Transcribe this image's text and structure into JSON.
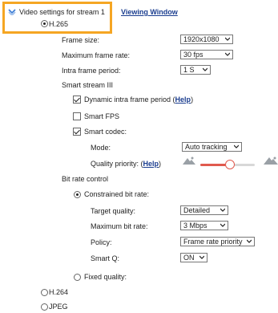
{
  "header": {
    "title": "Video settings for stream 1",
    "viewing_window_link": "Viewing Window"
  },
  "codec": {
    "h265_label": "H.265",
    "h264_label": "H.264",
    "jpeg_label": "JPEG",
    "selected": "H.265"
  },
  "fields": {
    "frame_size_label": "Frame size:",
    "frame_size_value": "1920x1080",
    "max_frame_rate_label": "Maximum frame rate:",
    "max_frame_rate_value": "30 fps",
    "intra_frame_period_label": "Intra frame period:",
    "intra_frame_period_value": "1 S"
  },
  "smart_stream": {
    "title": "Smart stream III",
    "dynamic_intra_label": "Dynamic intra frame period (",
    "dynamic_intra_help": "Help",
    "dynamic_intra_close": ")",
    "dynamic_intra_checked": true,
    "smart_fps_label": "Smart FPS",
    "smart_fps_checked": false,
    "smart_codec_label": "Smart codec:",
    "smart_codec_checked": true,
    "mode_label": "Mode:",
    "mode_value": "Auto tracking",
    "quality_priority_label": "Quality priority: (",
    "quality_priority_help": "Help",
    "quality_priority_close": ")",
    "quality_priority_level": 0.55,
    "accent_color": "#e05a4e"
  },
  "bitrate": {
    "title": "Bit rate control",
    "constrained_label": "Constrained bit rate:",
    "constrained_selected": true,
    "target_quality_label": "Target quality:",
    "target_quality_value": "Detailed",
    "max_bitrate_label": "Maximum bit rate:",
    "max_bitrate_value": "3 Mbps",
    "policy_label": "Policy:",
    "policy_value": "Frame rate priority",
    "smart_q_label": "Smart Q:",
    "smart_q_value": "ON",
    "fixed_quality_label": "Fixed quality:",
    "fixed_quality_selected": false
  },
  "colors": {
    "highlight": "#f5a623",
    "link": "#1a3d8f"
  }
}
